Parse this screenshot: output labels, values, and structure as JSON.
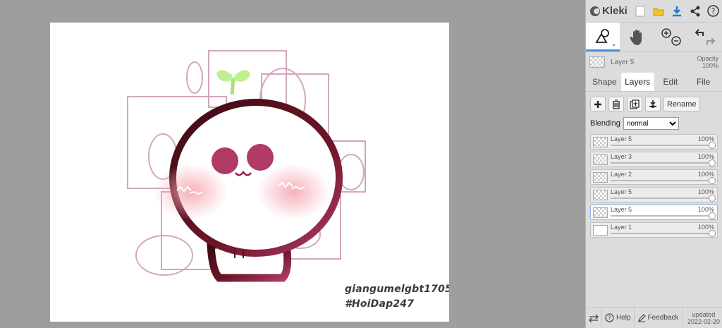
{
  "app": {
    "name": "Kleki"
  },
  "topbar": {
    "icons": [
      "new-image-icon",
      "open-folder-icon",
      "download-icon",
      "share-icon",
      "help-icon"
    ]
  },
  "tools": {
    "items": [
      "shape-tool-icon",
      "hand-tool-icon",
      "zoom-icon",
      "undo-redo-icon"
    ]
  },
  "current_layer": {
    "name": "Layer 5",
    "opacity_label": "Opacity",
    "opacity_value": "100%"
  },
  "tabs": [
    "Shape",
    "Layers",
    "Edit",
    "File"
  ],
  "active_tab": "Layers",
  "layer_actions": {
    "rename_label": "Rename"
  },
  "blending": {
    "label": "Blending",
    "value": "normal"
  },
  "layers": [
    {
      "name": "Layer 5",
      "opacity": "100%",
      "selected": false
    },
    {
      "name": "Layer 3",
      "opacity": "100%",
      "selected": false
    },
    {
      "name": "Layer 2",
      "opacity": "100%",
      "selected": false
    },
    {
      "name": "Layer 5",
      "opacity": "100%",
      "selected": false
    },
    {
      "name": "Layer 5",
      "opacity": "100%",
      "selected": true
    },
    {
      "name": "Layer 1",
      "opacity": "100%",
      "selected": false
    }
  ],
  "footer": {
    "help_label": "Help",
    "feedback_label": "Feedback",
    "updated_label": "updated",
    "updated_date": "2022-02-20"
  },
  "canvas": {
    "watermark_line1": "giangumelgbt1705",
    "watermark_line2": "#HoiDap247"
  },
  "colors": {
    "accent": "#4a90e2",
    "body_outline": "#5a1020",
    "blush": "#f3a9b4",
    "eyes": "#b23a67",
    "sprout": "#a6e27a"
  }
}
